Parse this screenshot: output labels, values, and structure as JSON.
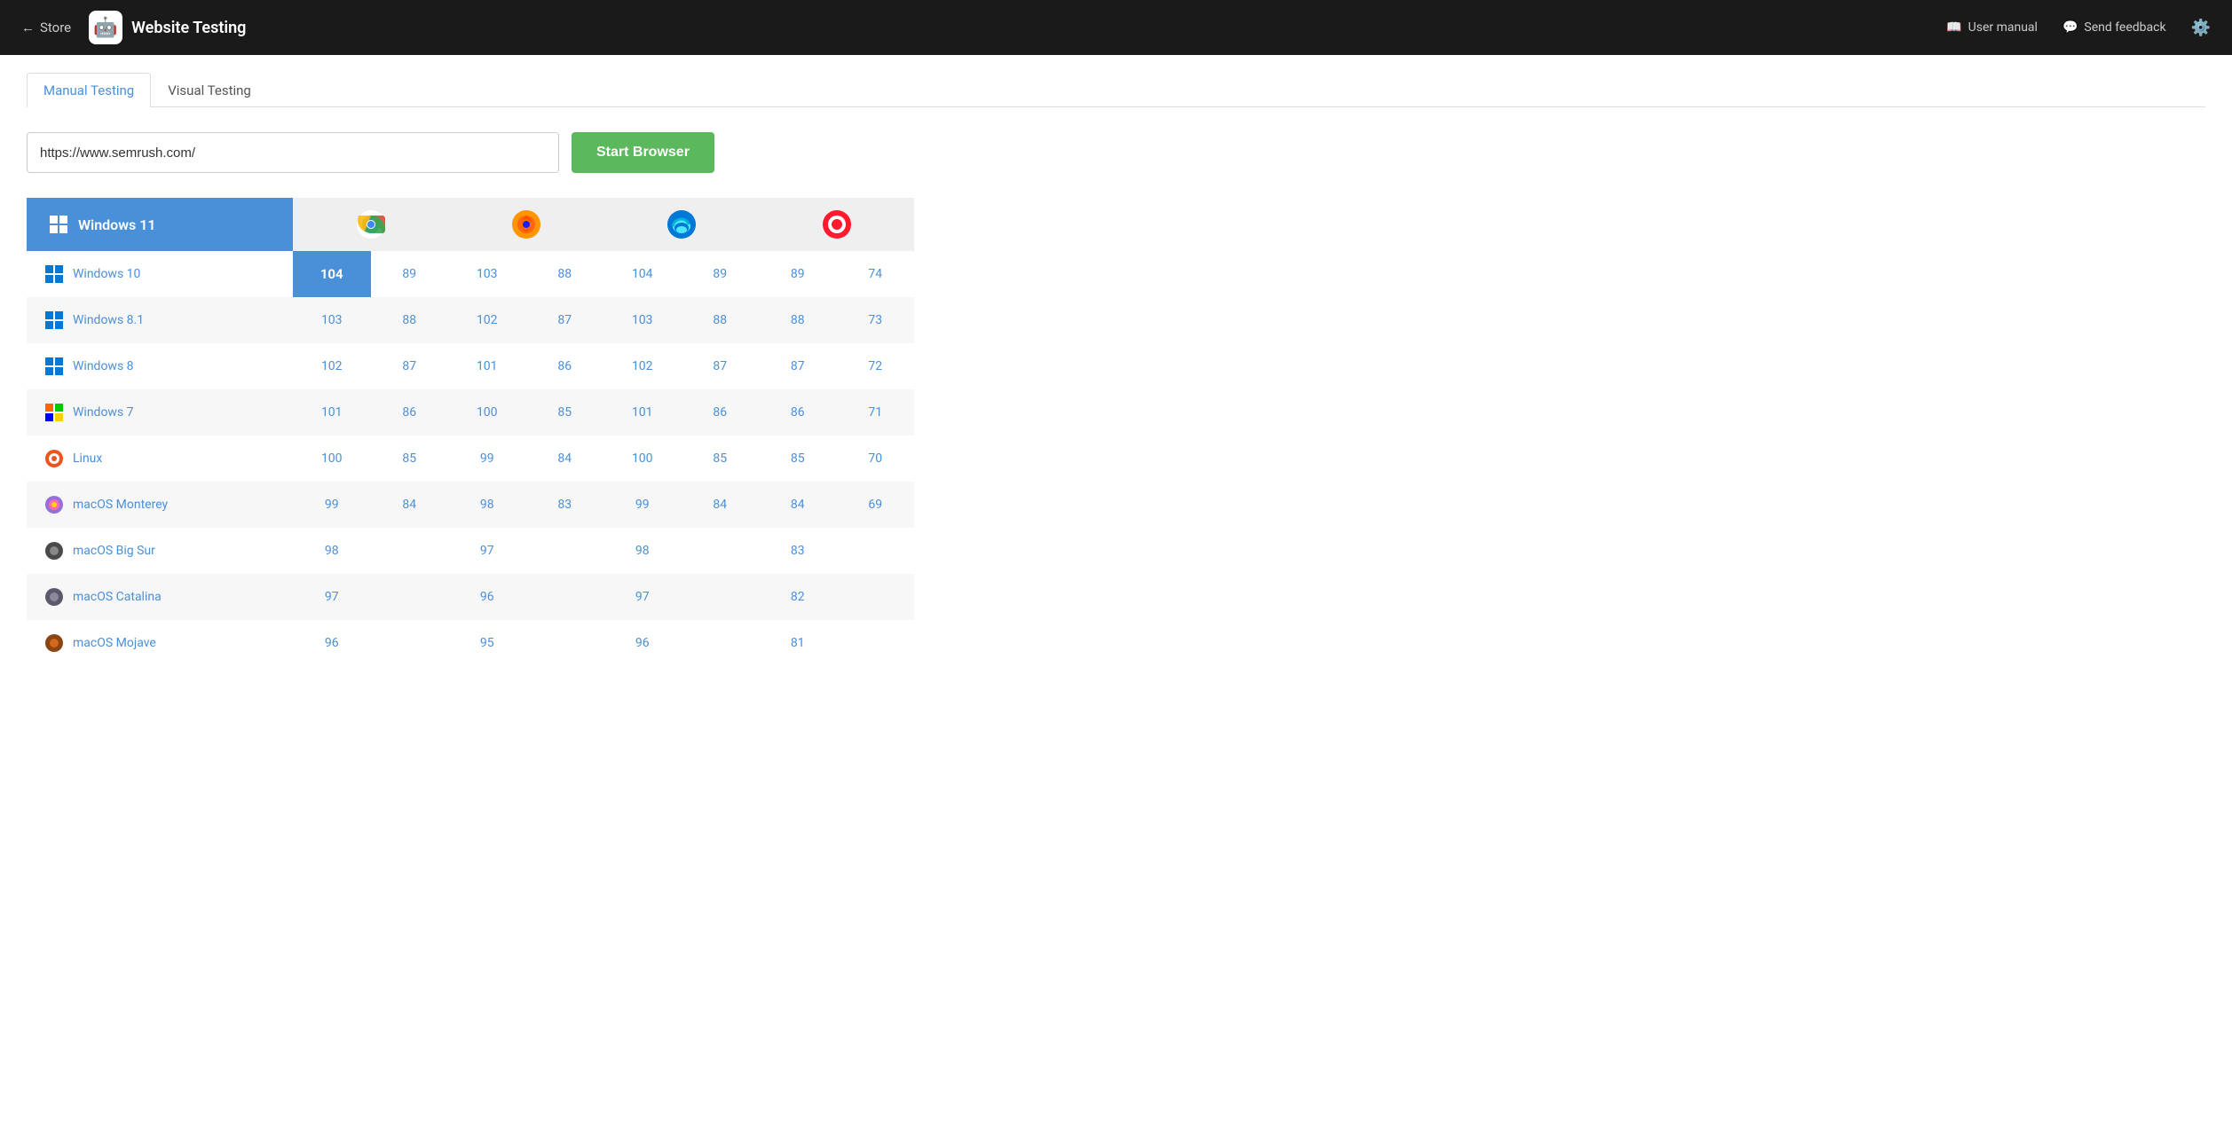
{
  "header": {
    "store_label": "Store",
    "app_name": "Website Testing",
    "user_manual_label": "User manual",
    "send_feedback_label": "Send feedback"
  },
  "tabs": [
    {
      "id": "manual",
      "label": "Manual Testing",
      "active": true
    },
    {
      "id": "visual",
      "label": "Visual Testing",
      "active": false
    }
  ],
  "url_bar": {
    "placeholder": "https://www.semrush.com/",
    "value": "https://www.semrush.com/",
    "button_label": "Start Browser"
  },
  "table": {
    "os_header": "Windows 11",
    "browsers": [
      "Chrome",
      "Firefox",
      "Edge",
      "Opera"
    ],
    "rows": [
      {
        "os": "Windows 10",
        "icon": "win10",
        "versions": [
          104,
          89,
          103,
          88,
          104,
          89,
          89,
          74
        ]
      },
      {
        "os": "Windows 8.1",
        "icon": "win8",
        "versions": [
          103,
          88,
          102,
          87,
          103,
          88,
          88,
          73
        ]
      },
      {
        "os": "Windows 8",
        "icon": "win8",
        "versions": [
          102,
          87,
          101,
          86,
          102,
          87,
          87,
          72
        ]
      },
      {
        "os": "Windows 7",
        "icon": "win7",
        "versions": [
          101,
          86,
          100,
          85,
          101,
          86,
          86,
          71
        ]
      },
      {
        "os": "Linux",
        "icon": "linux",
        "versions": [
          100,
          85,
          99,
          84,
          100,
          85,
          85,
          70
        ]
      },
      {
        "os": "macOS Monterey",
        "icon": "macos-monterey",
        "versions": [
          99,
          84,
          98,
          83,
          99,
          84,
          84,
          69
        ]
      },
      {
        "os": "macOS Big Sur",
        "icon": "macos-bigsur",
        "versions": [
          98,
          null,
          97,
          null,
          98,
          null,
          83,
          null
        ]
      },
      {
        "os": "macOS Catalina",
        "icon": "macos-catalina",
        "versions": [
          97,
          null,
          96,
          null,
          97,
          null,
          82,
          null
        ]
      },
      {
        "os": "macOS Mojave",
        "icon": "macos-mojave",
        "versions": [
          96,
          null,
          95,
          null,
          96,
          null,
          81,
          null
        ]
      }
    ]
  }
}
